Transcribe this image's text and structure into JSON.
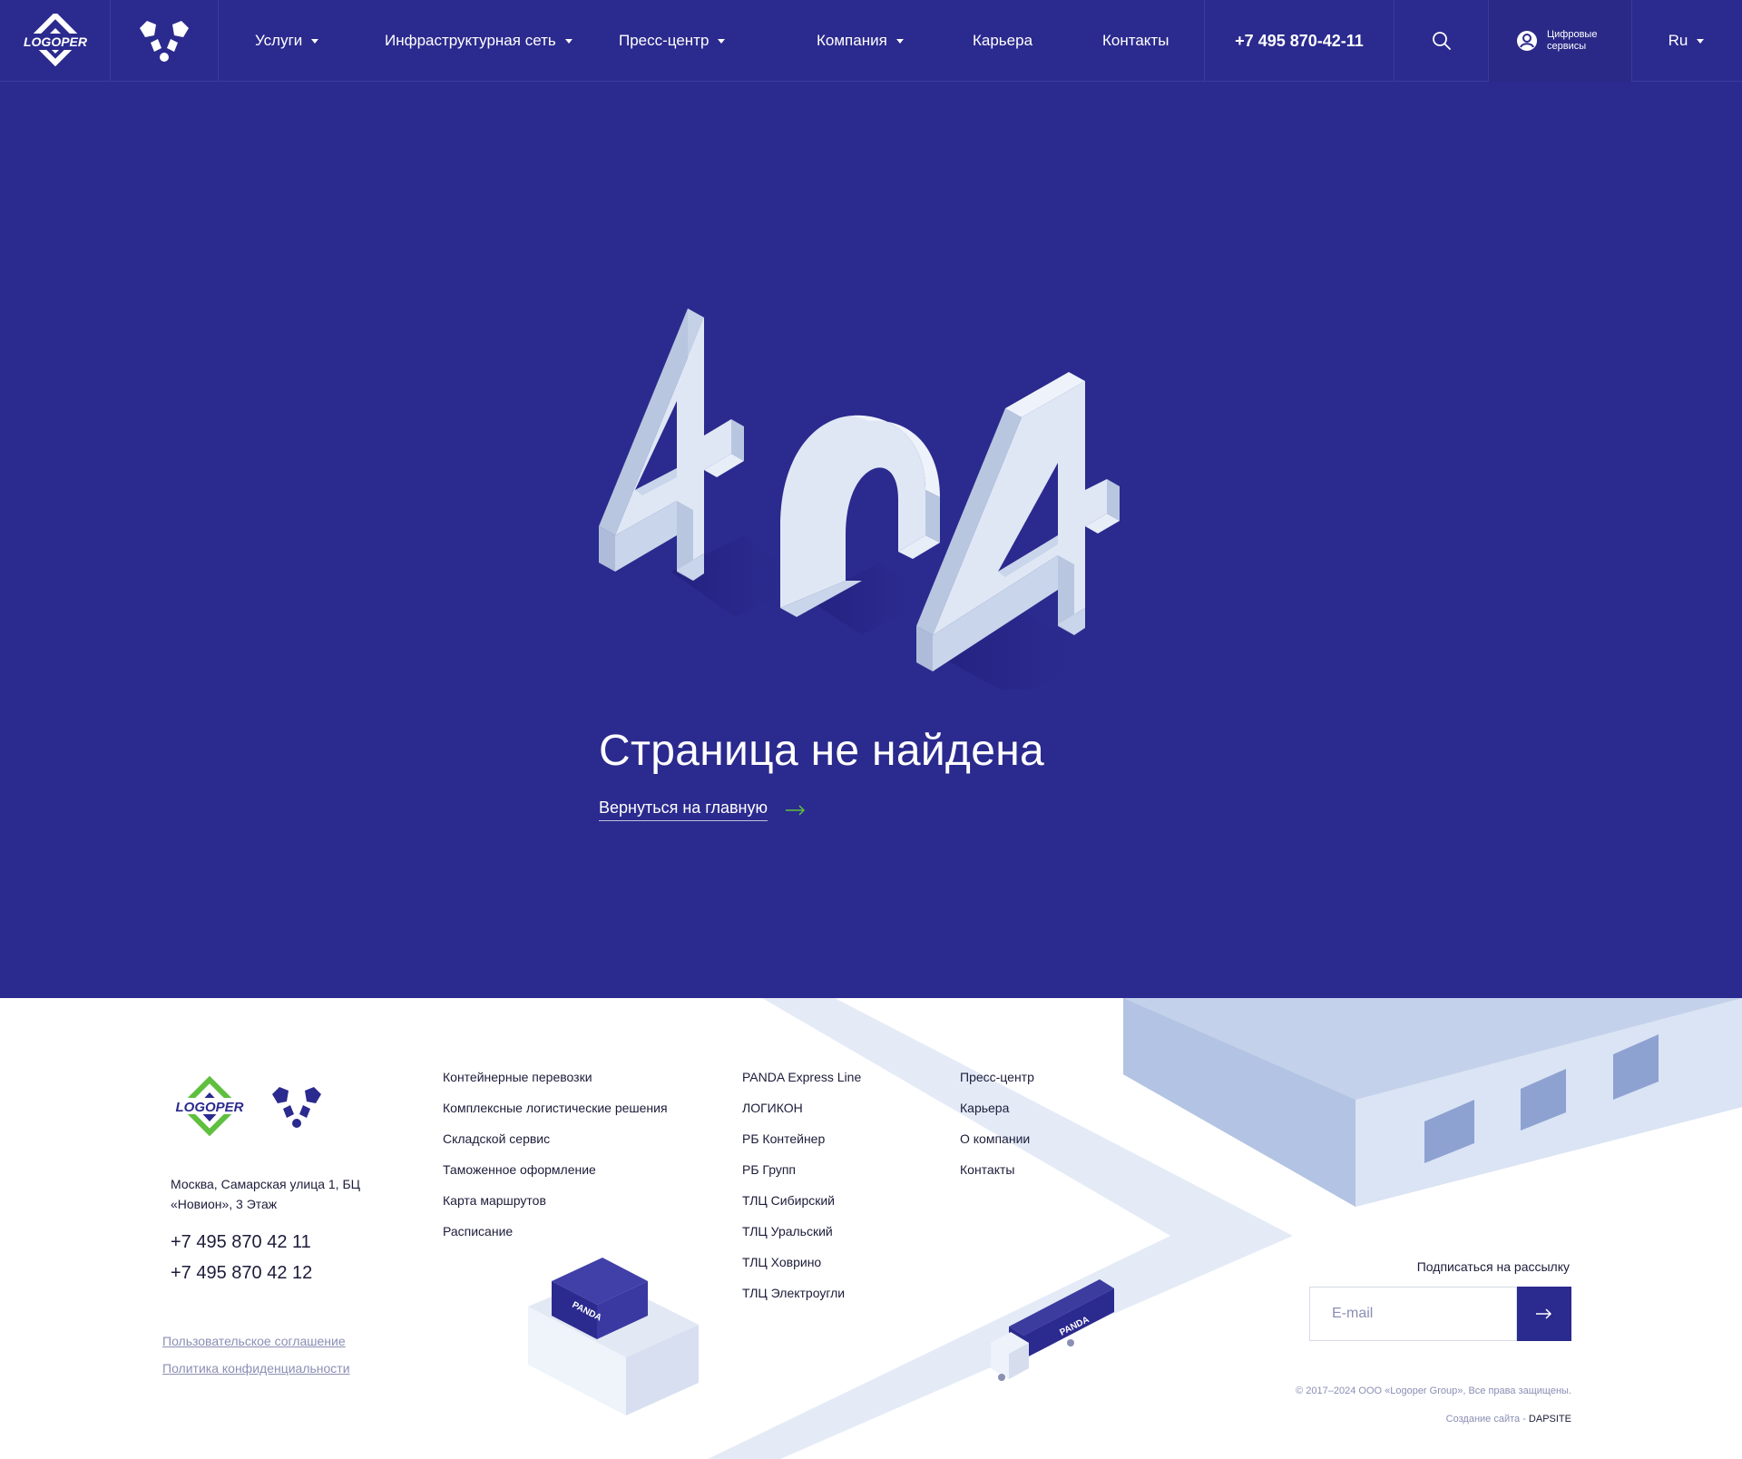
{
  "header": {
    "logo_text": "LOGOPER",
    "nav": [
      {
        "label": "Услуги",
        "dropdown": true
      },
      {
        "label": "Инфраструктурная сеть",
        "dropdown": true
      },
      {
        "label": "Пресс-центр",
        "dropdown": true
      },
      {
        "label": "Компания",
        "dropdown": true
      },
      {
        "label": "Карьера",
        "dropdown": false
      },
      {
        "label": "Контакты",
        "dropdown": false
      }
    ],
    "phone": "+7 495 870-42-11",
    "digital_services_line1": "Цифровые",
    "digital_services_line2": "сервисы",
    "language": "Ru",
    "icons": [
      "search-icon",
      "user-icon",
      "chevron-down-icon"
    ]
  },
  "hero": {
    "illustration_text": "404",
    "title": "Страница не найдена",
    "back_link": "Вернуться на главную"
  },
  "footer": {
    "logo_text": "LOGOPER",
    "address": "Москва, Самарская улица 1, БЦ «Новион», 3 Этаж",
    "phones": [
      "+7 495 870 42 11",
      "+7 495 870 42 12"
    ],
    "legal_links": [
      "Пользовательское соглашение",
      "Политика конфиденциальности"
    ],
    "col1": [
      "Контейнерные перевозки",
      "Комплексные логистические решения",
      "Складской сервис",
      "Таможенное оформление",
      "Карта маршрутов",
      "Расписание"
    ],
    "col2": [
      "PANDA Express Line",
      "ЛОГИКОН",
      "РБ Контейнер",
      "РБ Групп",
      "ТЛЦ Сибирский",
      "ТЛЦ Уральский",
      "ТЛЦ Ховрино",
      "ТЛЦ Электроугли"
    ],
    "col3": [
      "Пресс-центр",
      "Карьера",
      "О компании",
      "Контакты"
    ],
    "subscribe_label": "Подписаться на рассылку",
    "email_placeholder": "E-mail",
    "copyright": "© 2017–2024 ООО «Logoper Group», Все права защищены.",
    "made_by_prefix": "Создание сайта - ",
    "made_by_name": "DAPSITE",
    "container_brand": "PANDA"
  },
  "colors": {
    "brand_blue": "#2b2a8e",
    "accent_green": "#5fbf3f",
    "light_block": "#d4dff0",
    "footer_road": "#e4ebf7"
  }
}
